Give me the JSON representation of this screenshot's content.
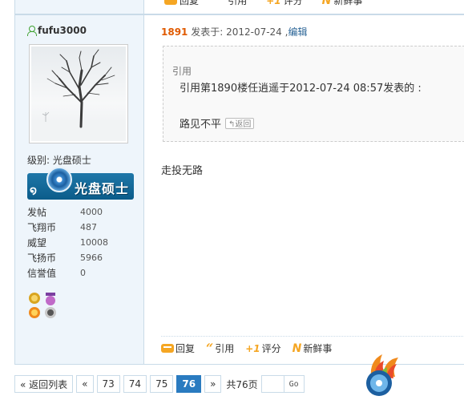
{
  "top_actions": {
    "reply": "回复",
    "quote": "引用",
    "rate": "评分",
    "news": "新鲜事"
  },
  "post": {
    "username": "fufu3000",
    "level_label": "级别: 光盘硕士",
    "rank_badge_text": "光盘硕士",
    "stats": [
      {
        "label": "发帖",
        "value": "4000"
      },
      {
        "label": "飞翔币",
        "value": "487"
      },
      {
        "label": "威望",
        "value": "10008"
      },
      {
        "label": "飞扬币",
        "value": "5966"
      },
      {
        "label": "信誉值",
        "value": "0"
      }
    ],
    "floor": "1891",
    "posted_at": " 发表于: 2012-07-24 ,",
    "edit_link": "编辑",
    "quote": {
      "label": "引用",
      "header": "引用第1890楼任逍遥于2012-07-24 08:57发表的 :",
      "text": "路见不平",
      "back_button": "↰返回"
    },
    "message": "走投无路",
    "actions": {
      "reply": "回复",
      "quote": "引用",
      "rate": "评分",
      "news": "新鲜事"
    }
  },
  "pagination": {
    "back_to_list": "« 返回列表",
    "prev": "«",
    "pages": [
      "73",
      "74",
      "75"
    ],
    "current": "76",
    "next": "»",
    "total": "共76页",
    "go": "Go"
  },
  "colors": {
    "accent": "#2a7bc0",
    "sidebar_bg": "#eef5fb",
    "floor": "#e05a00",
    "action_icon": "#f5a623"
  }
}
